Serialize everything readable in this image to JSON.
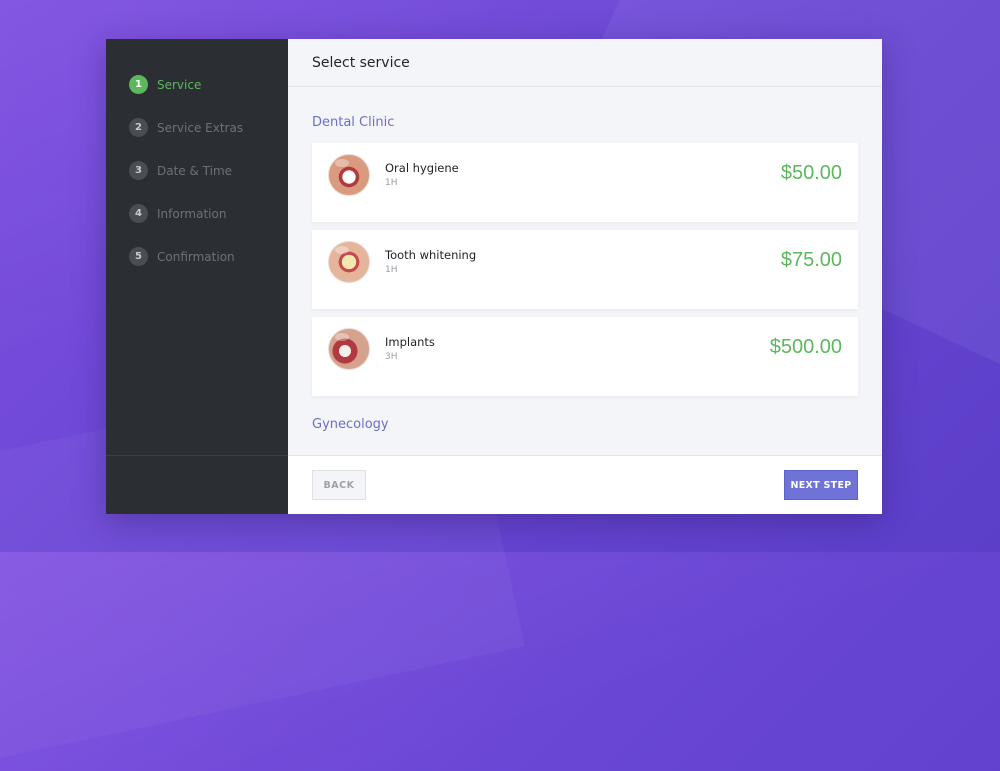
{
  "steps": [
    {
      "num": "1",
      "label": "Service",
      "active": true
    },
    {
      "num": "2",
      "label": "Service Extras",
      "active": false
    },
    {
      "num": "3",
      "label": "Date & Time",
      "active": false
    },
    {
      "num": "4",
      "label": "Information",
      "active": false
    },
    {
      "num": "5",
      "label": "Confirmation",
      "active": false
    }
  ],
  "header": {
    "title": "Select service"
  },
  "categories": [
    {
      "name": "Dental Clinic",
      "services": [
        {
          "name": "Oral hygiene",
          "duration": "1H",
          "price": "$50.00"
        },
        {
          "name": "Tooth whitening",
          "duration": "1H",
          "price": "$75.00"
        },
        {
          "name": "Implants",
          "duration": "3H",
          "price": "$500.00"
        }
      ]
    },
    {
      "name": "Gynecology",
      "services": []
    }
  ],
  "footer": {
    "back_label": "BACK",
    "next_label": "NEXT STEP"
  },
  "colors": {
    "accent_green": "#5cb85c",
    "accent_purple": "#6f72d6",
    "sidebar_bg": "#2b2e33"
  },
  "icons": {
    "service_thumbnails": [
      "oral-hygiene-photo",
      "tooth-whitening-photo",
      "implants-photo"
    ]
  }
}
